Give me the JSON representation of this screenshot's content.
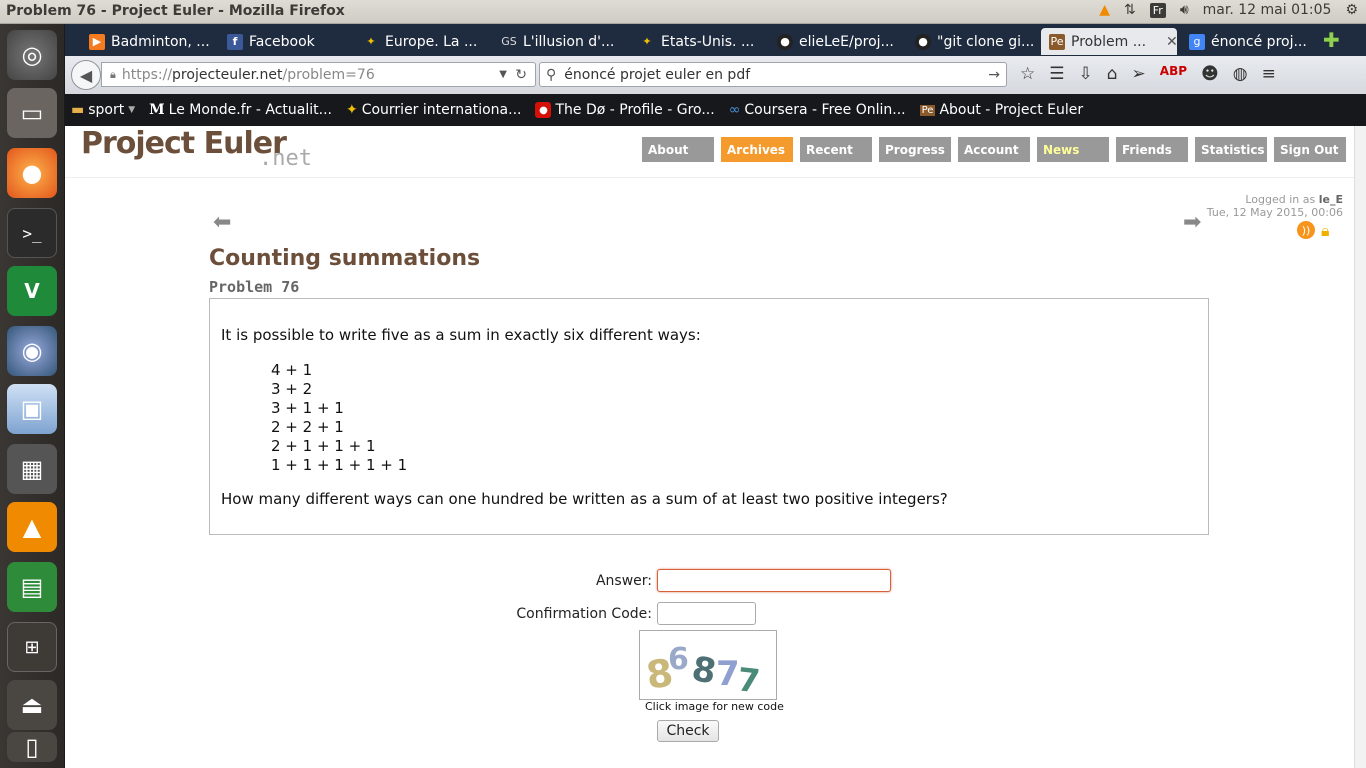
{
  "window": {
    "title": "Problem 76 - Project Euler - Mozilla Firefox"
  },
  "system": {
    "keyboard": "Fr",
    "clock": "mar. 12 mai 01:05"
  },
  "tabs": [
    {
      "label": "Badminton, ...",
      "icon": "badminton-icon",
      "color": "#f47b20"
    },
    {
      "label": "Facebook",
      "icon": "facebook-icon",
      "color": "#3b5998"
    },
    {
      "label": "Europe. La ...",
      "icon": "courrier-international-icon",
      "color": "#f0c000"
    },
    {
      "label": "L'illusion d'...",
      "icon": "gs-icon",
      "color": "#555555"
    },
    {
      "label": "Etats-Unis. ...",
      "icon": "courrier-international-icon",
      "color": "#f0c000"
    },
    {
      "label": "elieLeE/proj...",
      "icon": "github-icon",
      "color": "#222222"
    },
    {
      "label": "\"git clone gi...",
      "icon": "github-icon",
      "color": "#222222"
    },
    {
      "label": "Problem ...",
      "icon": "project-euler-icon",
      "color": "#8b5a2b"
    },
    {
      "label": "énoncé proj...",
      "icon": "google-icon",
      "color": "#4285f4"
    }
  ],
  "nav": {
    "url_prefix": "https://",
    "url_host": "projecteuler.net",
    "url_path": "/problem=76",
    "search": "énoncé projet euler en pdf"
  },
  "bookmarks": [
    {
      "label": "sport",
      "icon": "folder-icon"
    },
    {
      "label": "Le Monde.fr - Actualit...",
      "icon": "le-monde-icon"
    },
    {
      "label": "Courrier internationa...",
      "icon": "courrier-international-icon"
    },
    {
      "label": "The Dø - Profile - Gro...",
      "icon": "lastfm-icon"
    },
    {
      "label": "Coursera - Free Onlin...",
      "icon": "coursera-icon"
    },
    {
      "label": "About - Project Euler",
      "icon": "project-euler-icon"
    }
  ],
  "site": {
    "logo": "Project Euler",
    "logo_suffix": ".net",
    "menu": [
      "About",
      "Archives",
      "Recent",
      "Progress",
      "Account",
      "News",
      "Friends",
      "Statistics",
      "Sign Out"
    ],
    "active_menu": "Archives",
    "logged_in_label": "Logged in as",
    "username": "le_E",
    "datetime": "Tue, 12 May 2015, 00:06"
  },
  "problem": {
    "title": "Counting summations",
    "number": "Problem 76",
    "intro": "It is possible to write five as a sum in exactly six different ways:",
    "sums": [
      "4 + 1",
      "3 + 2",
      "3 + 1 + 1",
      "2 + 2 + 1",
      "2 + 1 + 1 + 1",
      "1 + 1 + 1 + 1 + 1"
    ],
    "question": "How many different ways can one hundred be written as a sum of at least two positive integers?"
  },
  "form": {
    "answer_label": "Answer:",
    "answer_value": "",
    "confirmation_label": "Confirmation Code:",
    "confirmation_value": "",
    "captcha_text": "86877",
    "captcha_note": "Click image for new code",
    "submit_label": "Check"
  }
}
